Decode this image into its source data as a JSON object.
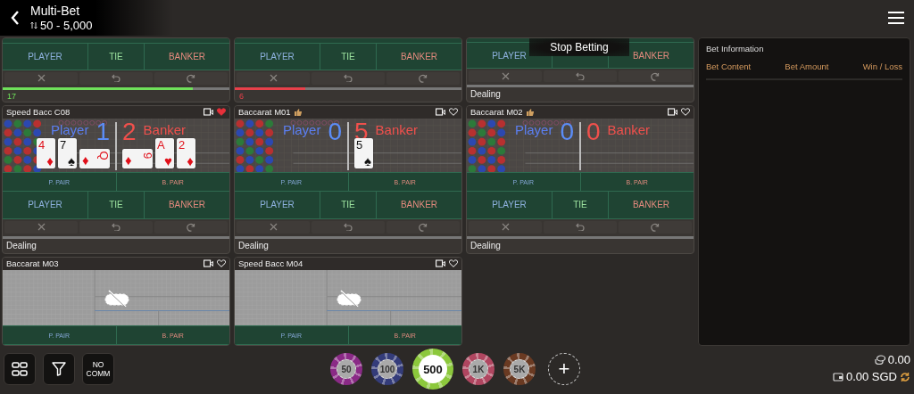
{
  "header": {
    "title": "Multi-Bet",
    "limit": "50 - 5,000"
  },
  "tables": [
    {
      "bets": [
        {
          "kind": "player",
          "label": "PLAYER"
        },
        {
          "kind": "tie",
          "label": "TIE"
        },
        {
          "kind": "banker",
          "label": "BANKER"
        }
      ],
      "timer": {
        "count": "17",
        "level": 0.84,
        "color": "#6fe05a"
      }
    },
    {
      "bets": [
        {
          "kind": "player",
          "label": "PLAYER"
        },
        {
          "kind": "tie",
          "label": "TIE"
        },
        {
          "kind": "banker",
          "label": "BANKER"
        }
      ],
      "timer": {
        "count": "6",
        "level": 0.31,
        "color": "#e8404a"
      }
    },
    {
      "notice": "Stop Betting",
      "bets": [
        {
          "kind": "player",
          "label": "PLAYER"
        },
        {
          "kind": "tie"
        },
        {
          "kind": "banker",
          "label": "BANKER"
        }
      ],
      "status": "Dealing"
    },
    {
      "title": "Speed Bacc C08",
      "liked": false,
      "favorite": true,
      "kind": "live",
      "player": {
        "label": "Player",
        "score": "1",
        "cards": [
          {
            "rank": "4",
            "suit": "♦",
            "red": true,
            "sideways": false
          },
          {
            "rank": "7",
            "suit": "♠",
            "red": false,
            "sideways": false
          },
          {
            "rank": "Q",
            "suit": "♦",
            "red": true,
            "sideways": true
          }
        ]
      },
      "banker": {
        "label": "Banker",
        "score": "2",
        "cards": [
          {
            "rank": "9",
            "suit": "♦",
            "red": true,
            "sideways": true
          },
          {
            "rank": "A",
            "suit": "♥",
            "red": true,
            "sideways": false
          },
          {
            "rank": "2",
            "suit": "♦",
            "red": true,
            "sideways": false
          }
        ]
      },
      "pairs": [
        {
          "kind": "player",
          "label": "P. PAIR"
        },
        {
          "kind": "banker",
          "label": "B. PAIR"
        }
      ],
      "bets": [
        {
          "kind": "player",
          "label": "PLAYER"
        },
        {
          "kind": "tie",
          "label": "TIE"
        },
        {
          "kind": "banker",
          "label": "BANKER"
        }
      ],
      "status": "Dealing"
    },
    {
      "title": "Baccarat M01",
      "liked": true,
      "favorite": false,
      "kind": "live",
      "player": {
        "label": "Player",
        "score": "0"
      },
      "banker": {
        "label": "Banker",
        "score": "5",
        "cards": [
          {
            "rank": "5",
            "suit": "♠",
            "red": false,
            "sideways": false
          }
        ]
      },
      "pairs": [
        {
          "kind": "player",
          "label": "P. PAIR"
        },
        {
          "kind": "banker",
          "label": "B. PAIR"
        }
      ],
      "bets": [
        {
          "kind": "player",
          "label": "PLAYER"
        },
        {
          "kind": "tie",
          "label": "TIE"
        },
        {
          "kind": "banker",
          "label": "BANKER"
        }
      ],
      "status": "Dealing"
    },
    {
      "title": "Baccarat M02",
      "liked": true,
      "favorite": false,
      "kind": "live",
      "player": {
        "label": "Player",
        "score": "0"
      },
      "banker": {
        "label": "Banker",
        "score": "0"
      },
      "pairs": [
        {
          "kind": "player",
          "label": "P. PAIR"
        },
        {
          "kind": "banker",
          "label": "B. PAIR"
        }
      ],
      "bets": [
        {
          "kind": "player",
          "label": "PLAYER"
        },
        {
          "kind": "tie",
          "label": "TIE"
        },
        {
          "kind": "banker",
          "label": "BANKER"
        }
      ],
      "status": "Dealing"
    },
    {
      "title": "Baccarat M03",
      "liked": false,
      "favorite": false,
      "kind": "closed",
      "pairs": [
        {
          "kind": "player",
          "label": "P. PAIR"
        },
        {
          "kind": "banker",
          "label": "B. PAIR"
        }
      ]
    },
    {
      "title": "Speed Bacc M04",
      "liked": false,
      "favorite": false,
      "kind": "closed",
      "pairs": [
        {
          "kind": "player",
          "label": "P. PAIR"
        },
        {
          "kind": "banker",
          "label": "B. PAIR"
        }
      ]
    }
  ],
  "bet_info": {
    "title": "Bet Information",
    "columns": [
      "Bet Content",
      "Bet Amount",
      "Win / Loss"
    ]
  },
  "toolbar": {
    "no_comm": "NO COMM"
  },
  "chips": [
    {
      "value": "50",
      "color": "#8a2a86",
      "selected": false
    },
    {
      "value": "100",
      "color": "#343c7a",
      "selected": false
    },
    {
      "value": "500",
      "color": "#8cc83c",
      "selected": true
    },
    {
      "value": "1K",
      "color": "#b04660",
      "selected": false
    },
    {
      "value": "5K",
      "color": "#6a3a22",
      "selected": false
    }
  ],
  "add_chip": "+",
  "balance": {
    "bet_total": "0.00",
    "wallet": "0.00 SGD"
  }
}
